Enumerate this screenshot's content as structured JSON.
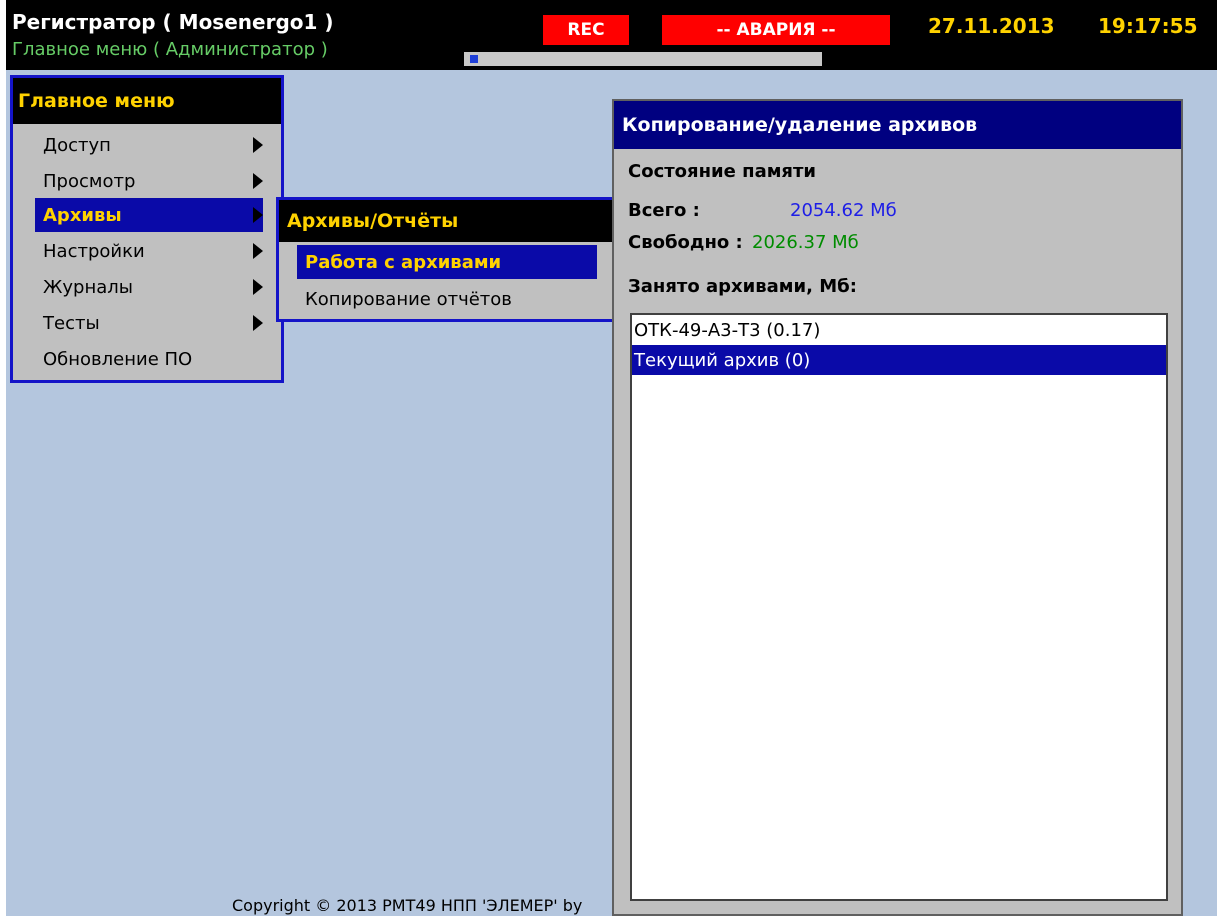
{
  "header": {
    "title": "Регистратор ( Mosenergo1 )",
    "subtitle": "Главное меню ( Администратор )",
    "rec_label": "REC",
    "alarm_label": "-- АВАРИЯ --",
    "date": "27.11.2013",
    "time": "19:17:55",
    "progress_fraction": 0.02
  },
  "main_menu": {
    "title": "Главное меню",
    "items": [
      {
        "label": "Доступ",
        "has_submenu": true
      },
      {
        "label": "Просмотр",
        "has_submenu": true
      },
      {
        "label": "Архивы",
        "has_submenu": true,
        "active": true
      },
      {
        "label": "Настройки",
        "has_submenu": true
      },
      {
        "label": "Журналы",
        "has_submenu": true
      },
      {
        "label": "Тесты",
        "has_submenu": true
      },
      {
        "label": "Обновление ПО",
        "has_submenu": false
      }
    ]
  },
  "submenu": {
    "title": "Архивы/Отчёты",
    "items": [
      {
        "label": "Работа с архивами",
        "active": true
      },
      {
        "label": "Копирование отчётов"
      }
    ]
  },
  "archive_panel": {
    "title": "Копирование/удаление архивов",
    "memory_heading": "Состояние памяти",
    "total_label": "Всего :",
    "total_value": "2054.62 Мб",
    "free_label": "Свободно :",
    "free_value": "2026.37 Мб",
    "used_heading": "Занято архивами, Мб:",
    "archives": [
      {
        "label": "ОТК-49-А3-Т3 (0.17)",
        "selected": false
      },
      {
        "label": "Текущий архив (0)",
        "selected": true
      }
    ]
  },
  "footer": {
    "copyright": "Copyright © 2013 РМТ49 НПП 'ЭЛЕМЕР' by"
  },
  "colors": {
    "header_bg": "#000000",
    "desktop_bg": "#b4c6de",
    "menu_bg": "#c0c0c0",
    "menu_border": "#1414c8",
    "highlight_bg": "#0a0aa8",
    "highlight_text": "#ffd200",
    "alarm_red": "#ff0000",
    "total_value": "#1e1ee6",
    "free_value": "#008c00"
  }
}
